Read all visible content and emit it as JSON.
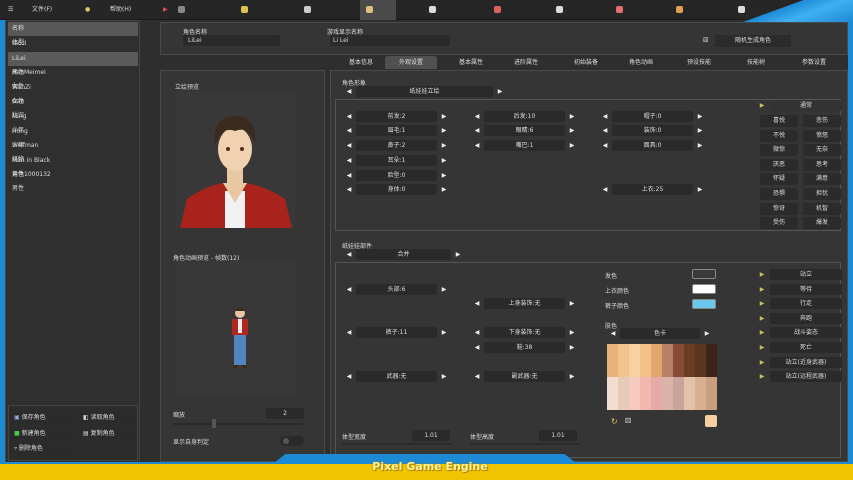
{
  "menu": {
    "file": "文件(F)",
    "help": "帮助(H)",
    "tabs": [
      "基本设置",
      "资源管理",
      "地图编辑",
      "角色编辑",
      "动画编辑",
      "事件编辑",
      "对话编辑",
      "道具编辑",
      "技能编辑",
      "技能树编辑"
    ],
    "active_tab": "角色编辑"
  },
  "character_list": {
    "headers": [
      "名称",
      "体型"
    ],
    "rows": [
      [
        "taozi",
        "女性"
      ],
      [
        "LiLei",
        "男性"
      ],
      [
        "HanMeimei",
        "女性"
      ],
      [
        "WanZi",
        "女性"
      ],
      [
        "Gao",
        "壮汉"
      ],
      [
        "Ming",
        "少年"
      ],
      [
        "Hong",
        "少年"
      ],
      [
        "Wolfman",
        "怪物"
      ],
      [
        "Man in Black",
        "男性"
      ],
      [
        "角色1000132",
        "男性"
      ]
    ],
    "selected": "LiLei"
  },
  "actions": {
    "save": "保存角色",
    "load": "读取角色",
    "new": "新建角色",
    "copy": "复制角色",
    "delete": "删除角色"
  },
  "info": {
    "name_label": "角色名称",
    "name_value": "LiLei",
    "display_label": "游戏显示名称",
    "display_value": "Li Lei",
    "random_button": "随机生成角色"
  },
  "tabs": [
    "基本信息",
    "外观设置",
    "基本属性",
    "进阶属性",
    "初始装备",
    "角色动画",
    "预设技能",
    "技能树",
    "参数设置"
  ],
  "active_tab": "外观设置",
  "preview": {
    "portrait_label": "立绘预览",
    "anim_label": "角色动画预览 - 帧数(12)",
    "scale_label": "缩放",
    "scale_value": "2",
    "show_hitbox_label": "显示自身判定",
    "show_hitbox": false
  },
  "appearance": {
    "label": "角色形象",
    "selector": "纸娃娃立绘",
    "steppers": [
      [
        "前发:2",
        "眉毛:1",
        "鼻子:2",
        "耳朵:1",
        "脸型:0",
        "身体:0"
      ],
      [
        "后发:10",
        "眼睛:6",
        "嘴巴:1"
      ],
      [
        "帽子:0",
        "装饰:0",
        "面具:0",
        "",
        "",
        "上衣:25"
      ]
    ],
    "expressions_header": "通常",
    "expressions": [
      "喜悦",
      "悲伤",
      "不悦",
      "愤怒",
      "微惊",
      "无奈",
      "厌恶",
      "思考",
      "怀疑",
      "满意",
      "恐惧",
      "担忧",
      "惊讶",
      "机智",
      "受伤",
      "爆发"
    ]
  },
  "parts": {
    "label": "纸娃娃部件",
    "selector": "合并",
    "steppers": {
      "head": "头部:6",
      "upper_deco": "上身装饰:无",
      "pants": "裤子:11",
      "lower_deco": "下身装饰:无",
      "shoes": "鞋:38",
      "weapon": "武器:无",
      "sub_weapon": "副武器:无"
    },
    "hair_color_label": "发色",
    "hair_color": "#3a3a3a",
    "top_color_label": "上衣颜色",
    "top_color": "#ffffff",
    "pants_color_label": "裤子颜色",
    "pants_color": "#6cc6ee",
    "skin_label": "肤色",
    "skin_selector": "色卡",
    "skin_color": "#f5cfa0",
    "palette_top": [
      "#e8b07a",
      "#f0c38f",
      "#f6d2a0",
      "#f3c089",
      "#e3a66f",
      "#b88068",
      "#8a4a38",
      "#6b3d24",
      "#5a3520",
      "#3e2416"
    ],
    "palette_bottom": [
      "#f2ddd0",
      "#e6cbb8",
      "#f6c9c0",
      "#f1b8b0",
      "#e7a8a8",
      "#d9b2a8",
      "#caa49a",
      "#e2c2a8",
      "#d8b090",
      "#c8a080"
    ],
    "animations": [
      "站立",
      "等待",
      "行走",
      "奔跑",
      "战斗姿态",
      "死亡",
      "站立(近身武器)",
      "站立(远程武器)"
    ],
    "width_label": "体型宽度",
    "width_value": "1.01",
    "height_label": "体型高度",
    "height_value": "1.01"
  },
  "footer": {
    "brand": "Pixel Game Engine"
  }
}
